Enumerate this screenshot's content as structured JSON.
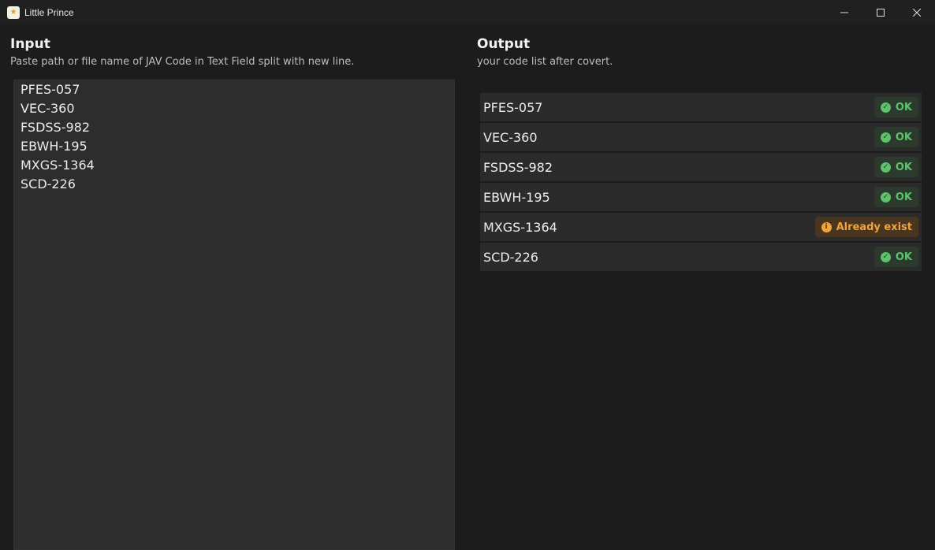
{
  "window": {
    "title": "Little Prince",
    "app_icon": "app-logo-icon",
    "controls": [
      "minimize-icon",
      "maximize-icon",
      "close-icon"
    ]
  },
  "input": {
    "title": "Input",
    "subtitle": "Paste path or file name of JAV Code in Text Field split with new line.",
    "lines": [
      "PFES-057",
      "VEC-360",
      "FSDSS-982",
      "EBWH-195",
      "MXGS-1364",
      "SCD-226"
    ]
  },
  "output": {
    "title": "Output",
    "subtitle": "your code list after covert.",
    "rows": [
      {
        "code": "PFES-057",
        "status": "OK",
        "status_type": "ok"
      },
      {
        "code": "VEC-360",
        "status": "OK",
        "status_type": "ok"
      },
      {
        "code": "FSDSS-982",
        "status": "OK",
        "status_type": "ok"
      },
      {
        "code": "EBWH-195",
        "status": "OK",
        "status_type": "ok"
      },
      {
        "code": "MXGS-1364",
        "status": "Already exist",
        "status_type": "warn"
      },
      {
        "code": "SCD-226",
        "status": "OK",
        "status_type": "ok"
      }
    ]
  },
  "colors": {
    "ok": "#5dc26a",
    "warn": "#f0a43a",
    "background": "#1c1c1c",
    "field": "#2d2d2d"
  }
}
